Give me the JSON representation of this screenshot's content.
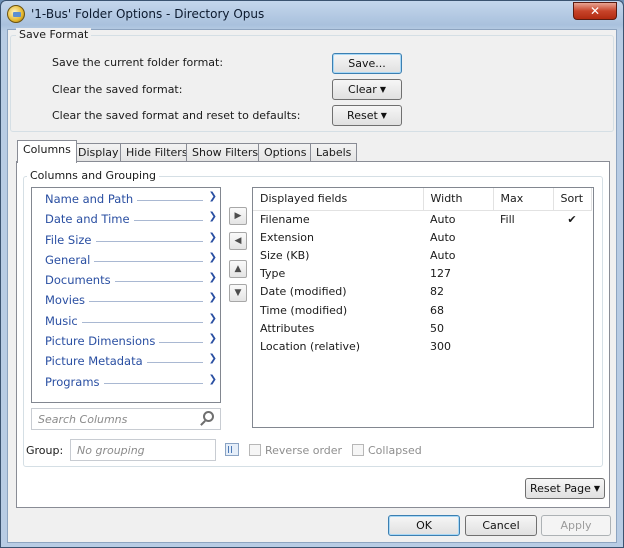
{
  "window": {
    "title": "'1-Bus' Folder Options - Directory Opus",
    "close_glyph": "✕"
  },
  "save_format": {
    "group_label": "Save Format",
    "rows": [
      {
        "label": "Save the current folder format:",
        "button": "Save..."
      },
      {
        "label": "Clear the saved format:",
        "button": "Clear"
      },
      {
        "label": "Clear the saved format and reset to defaults:",
        "button": "Reset"
      }
    ]
  },
  "tabs": [
    "Columns",
    "Display",
    "Hide Filters",
    "Show Filters",
    "Options",
    "Labels"
  ],
  "columns_group": {
    "label": "Columns and Grouping",
    "categories": [
      "Name and Path",
      "Date and Time",
      "File Size",
      "General",
      "Documents",
      "Movies",
      "Music",
      "Picture Dimensions",
      "Picture Metadata",
      "Programs"
    ],
    "search_placeholder": "Search Columns",
    "table": {
      "headers": [
        "Displayed fields",
        "Width",
        "Max",
        "Sort"
      ],
      "rows": [
        {
          "field": "Filename",
          "width": "Auto",
          "max": "Fill",
          "sort": "✔"
        },
        {
          "field": "Extension",
          "width": "Auto",
          "max": "",
          "sort": ""
        },
        {
          "field": "Size (KB)",
          "width": "Auto",
          "max": "",
          "sort": ""
        },
        {
          "field": "Type",
          "width": "127",
          "max": "",
          "sort": ""
        },
        {
          "field": "Date (modified)",
          "width": "82",
          "max": "",
          "sort": ""
        },
        {
          "field": "Time (modified)",
          "width": "68",
          "max": "",
          "sort": ""
        },
        {
          "field": "Attributes",
          "width": "50",
          "max": "",
          "sort": ""
        },
        {
          "field": "Location (relative)",
          "width": "300",
          "max": "",
          "sort": ""
        }
      ]
    },
    "group_label": "Group:",
    "group_placeholder": "No grouping",
    "reverse_order": "Reverse order",
    "collapsed": "Collapsed"
  },
  "reset_page": "Reset Page",
  "footer": {
    "ok": "OK",
    "cancel": "Cancel",
    "apply": "Apply"
  }
}
